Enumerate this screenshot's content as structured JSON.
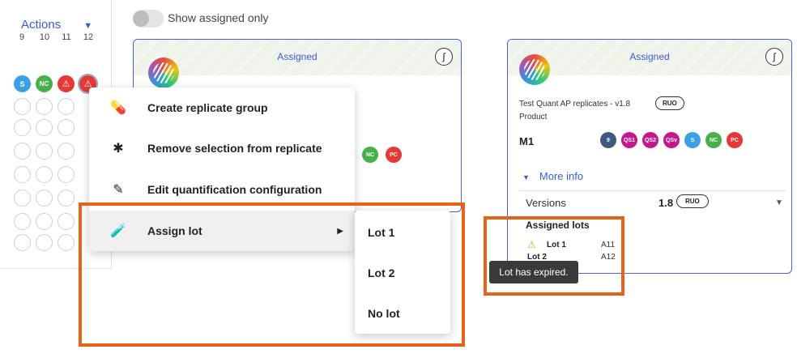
{
  "toolbar": {
    "actions_label": "Actions"
  },
  "plate": {
    "columns": [
      "9",
      "10",
      "11",
      "12"
    ],
    "row1": [
      {
        "type": "s",
        "label": "S"
      },
      {
        "type": "nc",
        "label": "NC"
      },
      {
        "type": "warn",
        "label": "⚠"
      },
      {
        "type": "warn",
        "label": "⚠"
      }
    ]
  },
  "filter": {
    "toggle_label": "Show assigned only",
    "toggle_on": false
  },
  "card1": {
    "title": "Assigned",
    "chips": [
      {
        "label": "NC",
        "color": "#46b04a"
      },
      {
        "label": "PC",
        "color": "#e53935"
      }
    ]
  },
  "card2": {
    "title": "Assigned",
    "product_name": "Test Quant AP replicates - v1.8",
    "product_badge": "RUO",
    "product_label": "Product",
    "method": "M1",
    "chips": [
      {
        "label": "9",
        "color": "#3d5a80"
      },
      {
        "label": "QS1",
        "color": "#c2188a"
      },
      {
        "label": "QS2",
        "color": "#c2188a"
      },
      {
        "label": "QSv",
        "color": "#c2188a"
      },
      {
        "label": "S",
        "color": "#3aa0e6"
      },
      {
        "label": "NC",
        "color": "#46b04a"
      },
      {
        "label": "PC",
        "color": "#e53935"
      }
    ],
    "more_info": "More info",
    "versions_label": "Versions",
    "versions_value": "1.8",
    "versions_badge": "RUO",
    "assigned_lots_heading": "Assigned lots",
    "lots": [
      {
        "name": "Lot 1",
        "position": "A11",
        "expired": true
      },
      {
        "name": "Lot 2",
        "position": "A12",
        "expired": false
      }
    ]
  },
  "tooltip": {
    "text": "Lot has expired."
  },
  "context_menu": {
    "items": [
      {
        "icon": "pill-icon",
        "label": "Create replicate group"
      },
      {
        "icon": "virus-icon",
        "label": "Remove selection from replicate"
      },
      {
        "icon": "pencil-icon",
        "label": "Edit quantification configuration"
      },
      {
        "icon": "vial-icon",
        "label": "Assign lot"
      }
    ],
    "submenu": [
      "Lot 1",
      "Lot 2",
      "No lot"
    ]
  },
  "colors": {
    "accent": "#3a5bd9",
    "highlight": "#e8621a",
    "warning": "#f0a500"
  }
}
